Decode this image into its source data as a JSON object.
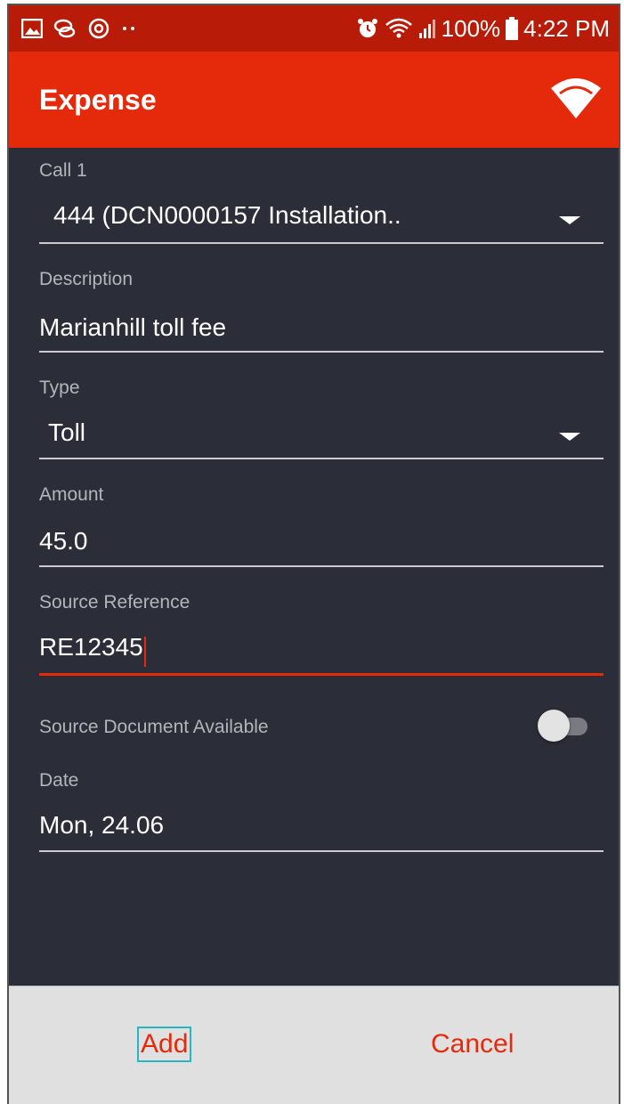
{
  "status_bar": {
    "left_icons": [
      "image-icon",
      "chat-bubbles-icon",
      "sync-icon",
      "more-dots-icon"
    ],
    "battery": "100%",
    "time": "4:22 PM"
  },
  "app_bar": {
    "title": "Expense"
  },
  "form": {
    "call": {
      "label": "Call 1",
      "value": "444 (DCN0000157 Installation.."
    },
    "description": {
      "label": "Description",
      "value": "Marianhill toll fee"
    },
    "type": {
      "label": "Type",
      "value": "Toll"
    },
    "amount": {
      "label": "Amount",
      "value": "45.0"
    },
    "source_reference": {
      "label": "Source Reference",
      "value": "RE12345"
    },
    "source_document": {
      "label": "Source Document Available",
      "checked": false
    },
    "date": {
      "label": "Date",
      "value": "Mon, 24.06"
    }
  },
  "actions": {
    "add_label": "Add",
    "cancel_label": "Cancel"
  },
  "colors": {
    "status_bar": "#b81c08",
    "accent": "#e5290b",
    "background": "#2b2d38",
    "bottom_bar": "#e0e0e0"
  }
}
